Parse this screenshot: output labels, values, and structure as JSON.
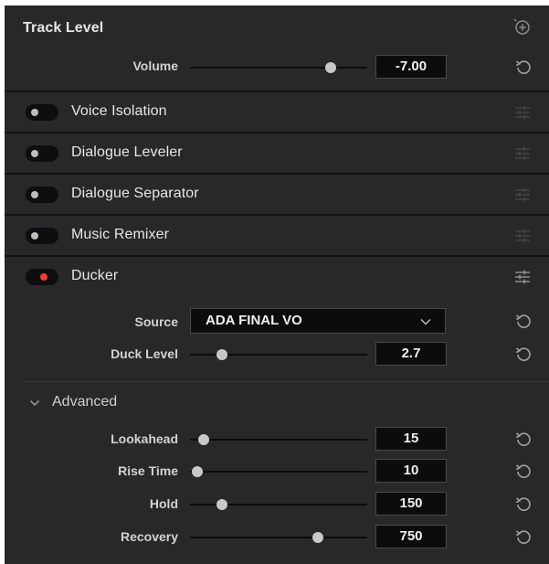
{
  "track_level": {
    "title": "Track Level",
    "volume_label": "Volume",
    "volume_value": "-7.00",
    "volume_level": 0.82
  },
  "effects": [
    {
      "label": "Voice Isolation",
      "enabled": false
    },
    {
      "label": "Dialogue Leveler",
      "enabled": false
    },
    {
      "label": "Dialogue Separator",
      "enabled": false
    },
    {
      "label": "Music Remixer",
      "enabled": false
    },
    {
      "label": "Ducker",
      "enabled": true
    }
  ],
  "ducker": {
    "source_label": "Source",
    "source_value": "ADA FINAL VO",
    "duck_level_label": "Duck Level",
    "duck_level_value": "2.7",
    "duck_level_fraction": 0.15
  },
  "advanced": {
    "label": "Advanced",
    "params": [
      {
        "label": "Lookahead",
        "value": "15",
        "fraction": 0.04
      },
      {
        "label": "Rise Time",
        "value": "10",
        "fraction": 0.0
      },
      {
        "label": "Hold",
        "value": "150",
        "fraction": 0.15
      },
      {
        "label": "Recovery",
        "value": "750",
        "fraction": 0.74
      }
    ]
  },
  "colors": {
    "panel_bg": "#1e1e20",
    "section_bg": "#28282a",
    "toggle_on": "#ff3b2f",
    "toggle_off": "#bdbdbd"
  },
  "icons": {
    "header_action": "add-circle-icon",
    "reset": "reset-icon",
    "effect_settings": "sliders-icon",
    "dropdown": "chevron-down-icon",
    "collapse": "chevron-down-icon"
  }
}
